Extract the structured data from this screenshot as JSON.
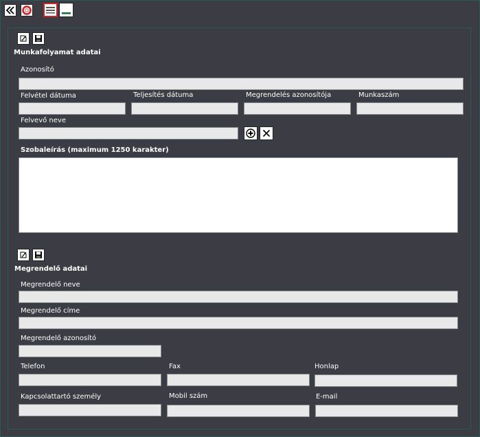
{
  "section1": {
    "title": "Munkafolyamat adatai",
    "azonosito_label": "Azonosító",
    "felvetel_label": "Felvétel dátuma",
    "teljesites_label": "Teljesítés dátuma",
    "megrendeles_az_label": "Megrendelés azonosítója",
    "munkaszam_label": "Munkaszám",
    "felvevo_label": "Felvevő neve",
    "szobaleiras_label": "Szobaleírás (maximum 1250 karakter)"
  },
  "section2": {
    "title": "Megrendelő adatai",
    "nev_label": "Megrendelő neve",
    "cim_label": "Megrendelő címe",
    "azonosito_label": "Megrendelő azonosító",
    "telefon_label": "Telefon",
    "fax_label": "Fax",
    "honlap_label": "Honlap",
    "kapcsolattarto_label": "Kapcsolattartó személy",
    "mobil_label": "Mobil szám",
    "email_label": "E-mail"
  },
  "colors": {
    "background": "#3c3c44",
    "field": "#e8e8e8",
    "border": "#2a5a5a",
    "accent_red": "#cc2222",
    "accent_green": "#1a6a3a"
  },
  "icons": {
    "back": "double-chevron-left-icon",
    "help": "lifebuoy-icon",
    "maximize": "menu-icon",
    "minimize": "minimize-icon",
    "edit": "edit-icon",
    "save": "floppy-disk-icon",
    "add": "plus-circle-icon",
    "remove": "x-icon"
  }
}
